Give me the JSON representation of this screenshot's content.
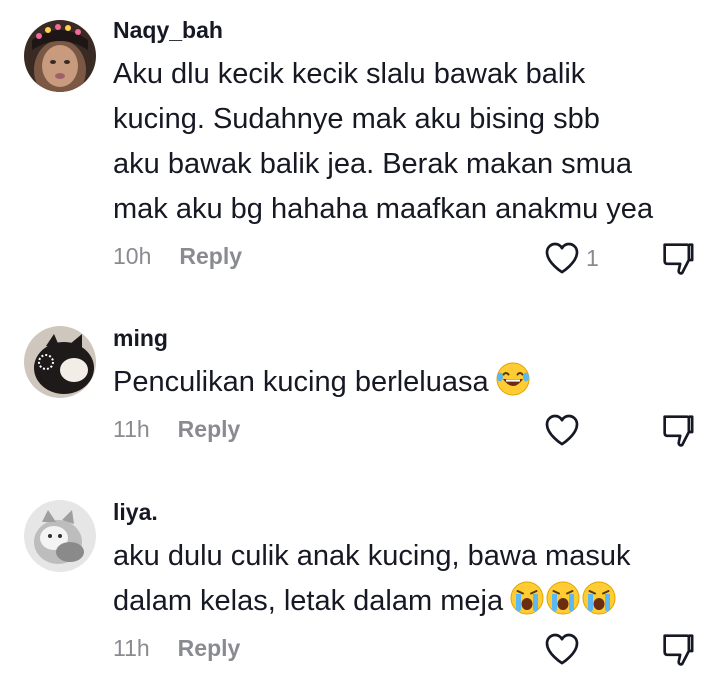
{
  "comments": [
    {
      "username": "Naqy_bah",
      "lines": [
        "Aku dlu kecik kecik slalu bawak balik",
        "kucing. Sudahnye mak aku bising sbb",
        "aku bawak balik jea. Berak makan smua",
        "mak aku bg hahaha maafkan anakmu yea"
      ],
      "time": "10h",
      "reply_label": "Reply",
      "like_count": "1"
    },
    {
      "username": "ming",
      "lines": [
        "Penculikan kucing berleluasa"
      ],
      "emojis": [
        "laughing-tears"
      ],
      "time": "11h",
      "reply_label": "Reply"
    },
    {
      "username": "liya.",
      "lines": [
        "aku dulu culik anak kucing, bawa masuk",
        "dalam kelas, letak dalam meja"
      ],
      "emojis": [
        "loudly-crying",
        "loudly-crying",
        "loudly-crying"
      ],
      "time": "11h",
      "reply_label": "Reply"
    }
  ],
  "colors": {
    "text": "#161823",
    "muted": "#8a8b91",
    "icon": "#161823"
  }
}
